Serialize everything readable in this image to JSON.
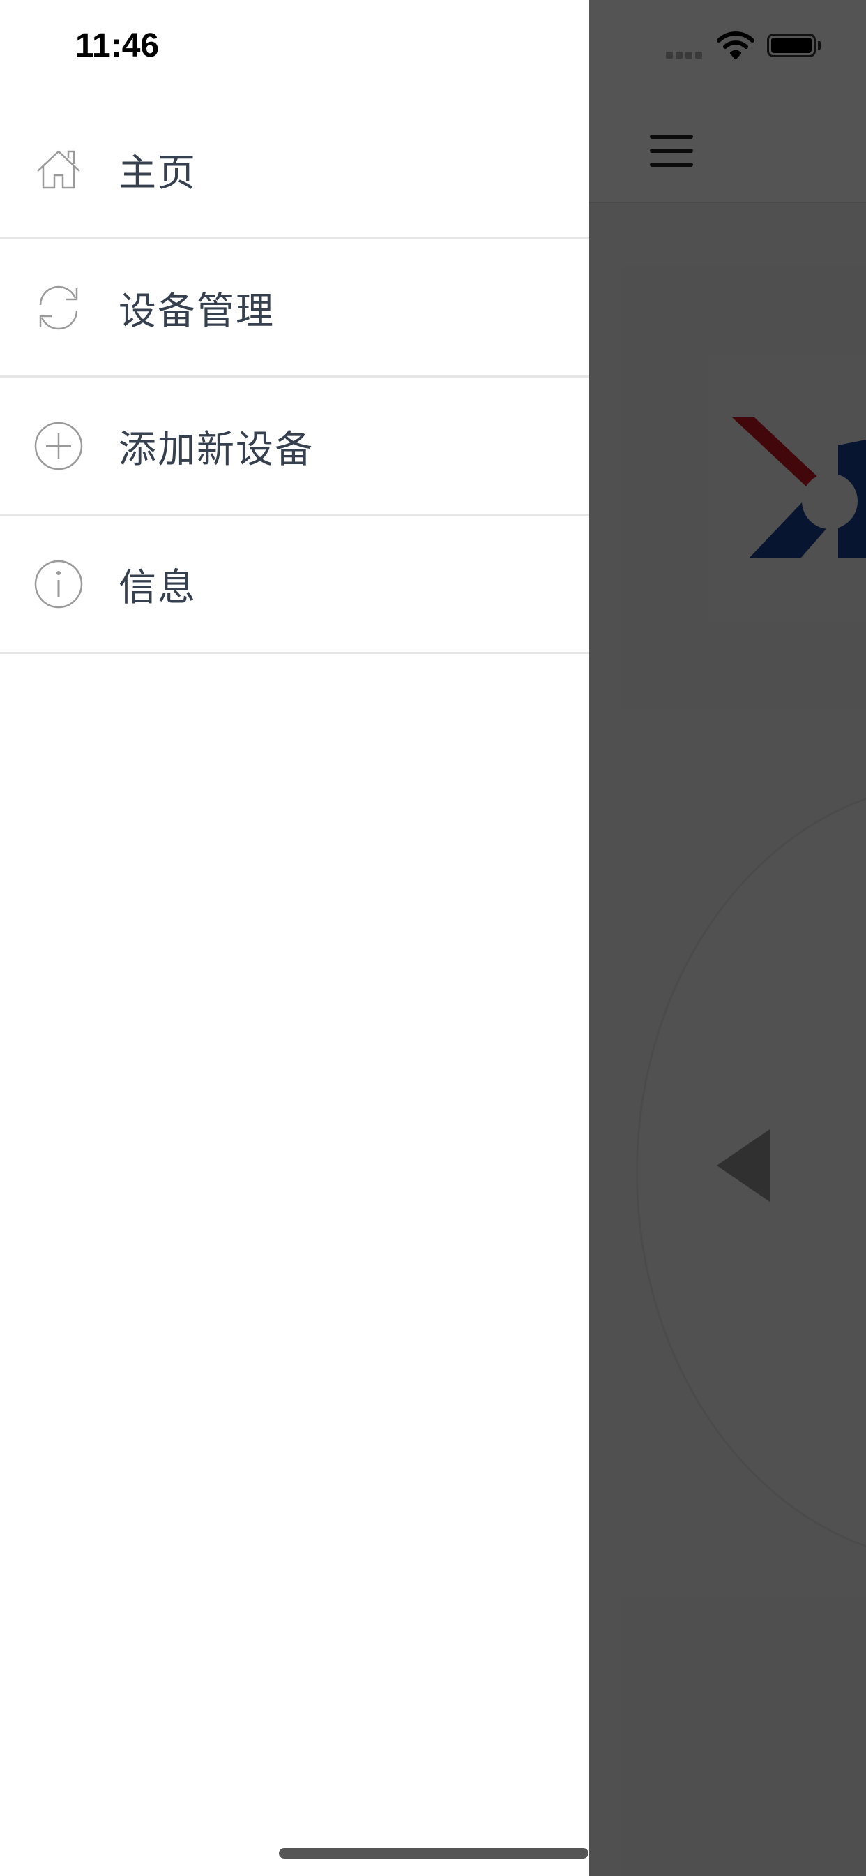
{
  "status_bar": {
    "time": "11:46",
    "icons": [
      "signal-icon",
      "wifi-icon",
      "battery-icon"
    ]
  },
  "drawer": {
    "items": [
      {
        "icon": "home-icon",
        "label": "主页"
      },
      {
        "icon": "refresh-icon",
        "label": "设备管理"
      },
      {
        "icon": "add-circle-icon",
        "label": "添加新设备"
      },
      {
        "icon": "info-icon",
        "label": "信息"
      }
    ]
  },
  "background_app": {
    "icons": [
      "hamburger-menu-icon",
      "brand-logo",
      "left-arrow-icon"
    ]
  },
  "colors": {
    "menu_text": "#36404e",
    "icon_stroke": "#9a9a9a",
    "logo_red": "#c0151f",
    "logo_blue": "#163f8c",
    "overlay": "#000000"
  }
}
